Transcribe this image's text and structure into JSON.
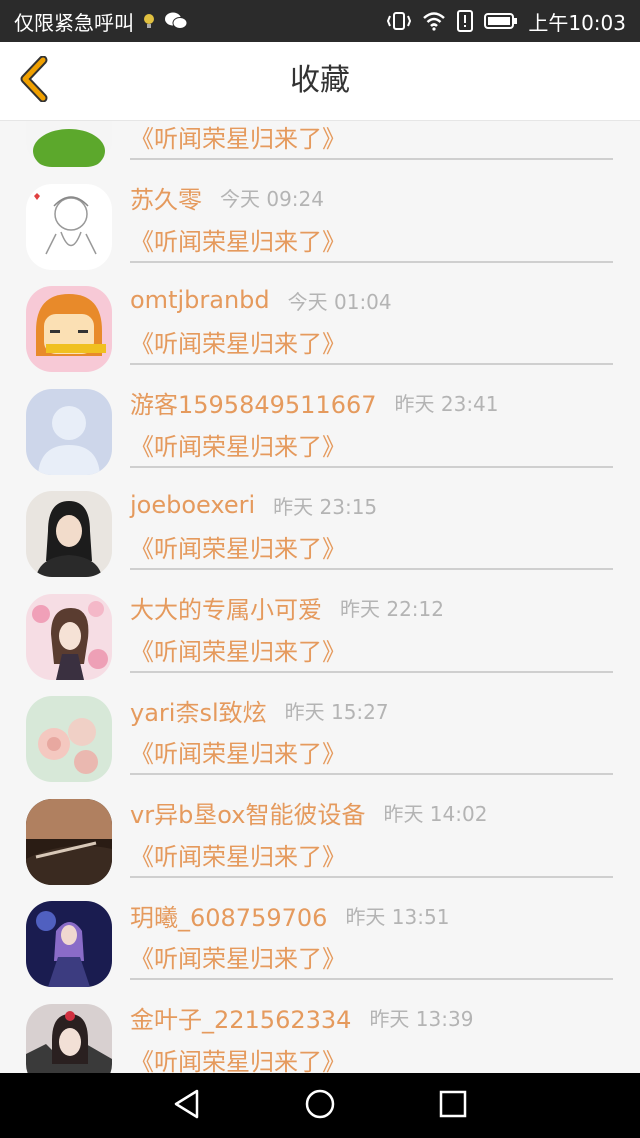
{
  "status_bar": {
    "carrier": "仅限紧急呼叫",
    "time": "上午10:03",
    "icons": [
      "lightbulb-icon",
      "wechat-icon",
      "vibrate-icon",
      "wifi-icon",
      "alert-icon",
      "battery-icon"
    ]
  },
  "header": {
    "title": "收藏",
    "back_icon": "chevron-left-icon",
    "accent": "#f0a000"
  },
  "colors": {
    "name": "#e59a5d",
    "time": "#b4b4b4",
    "divider": "#cfcfcf"
  },
  "items": [
    {
      "name": "",
      "time": "",
      "book": "《听闻荣星归来了》"
    },
    {
      "name": "苏久零",
      "time": "今天 09:24",
      "book": "《听闻荣星归来了》"
    },
    {
      "name": "omtjbranbd",
      "time": "今天 01:04",
      "book": "《听闻荣星归来了》"
    },
    {
      "name": "游客1595849511667",
      "time": "昨天 23:41",
      "book": "《听闻荣星归来了》"
    },
    {
      "name": "joeboexeri",
      "time": "昨天 23:15",
      "book": "《听闻荣星归来了》"
    },
    {
      "name": "大大的专属小可爱",
      "time": "昨天 22:12",
      "book": "《听闻荣星归来了》"
    },
    {
      "name": "yari柰sl致炫",
      "time": "昨天 15:27",
      "book": "《听闻荣星归来了》"
    },
    {
      "name": "vr异b垦ox智能彼设备",
      "time": "昨天 14:02",
      "book": "《听闻荣星归来了》"
    },
    {
      "name": "玥曦_608759706",
      "time": "昨天 13:51",
      "book": "《听闻荣星归来了》"
    },
    {
      "name": "金叶子_221562334",
      "time": "昨天 13:39",
      "book": "《听闻荣星归来了》"
    }
  ],
  "nav_bar": {
    "icons": [
      "back-triangle-icon",
      "home-circle-icon",
      "recents-square-icon"
    ]
  }
}
